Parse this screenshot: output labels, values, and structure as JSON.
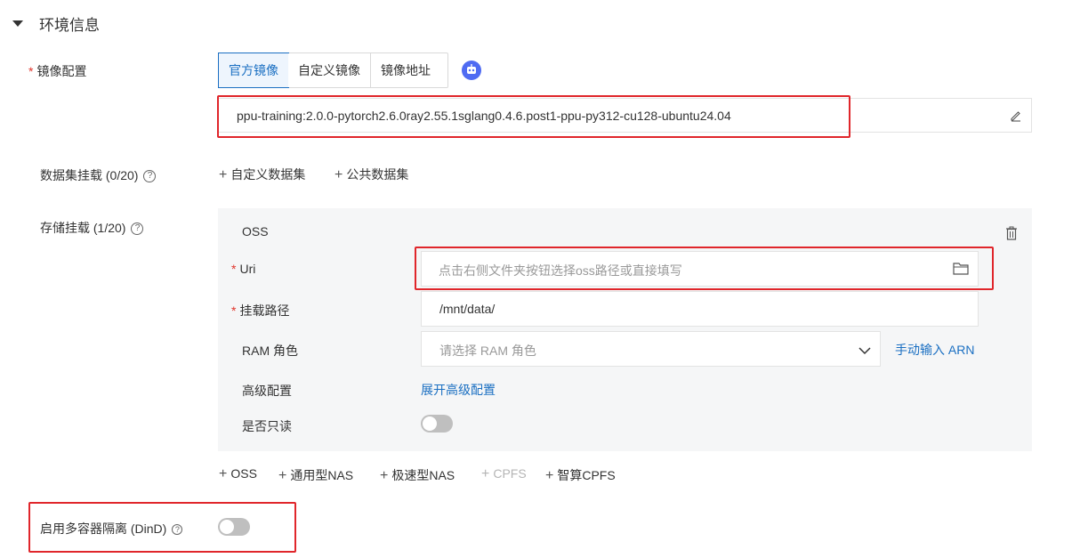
{
  "section": {
    "title": "环境信息"
  },
  "image_config": {
    "label": "镜像配置",
    "tabs": [
      "官方镜像",
      "自定义镜像",
      "镜像地址"
    ],
    "active_tab": "官方镜像",
    "value": "ppu-training:2.0.0-pytorch2.6.0ray2.55.1sglang0.4.6.post1-ppu-py312-cu128-ubuntu24.04"
  },
  "dataset_mount": {
    "label": "数据集挂载 (0/20)",
    "add_custom": "自定义数据集",
    "add_public": "公共数据集"
  },
  "storage_mount": {
    "label": "存储挂载 (1/20)",
    "card_title": "OSS",
    "uri_label": "Uri",
    "uri_placeholder": "点击右侧文件夹按钮选择oss路径或直接填写",
    "mount_path_label": "挂载路径",
    "mount_path_value": "/mnt/data/",
    "ram_role_label": "RAM 角色",
    "ram_role_placeholder": "请选择 RAM 角色",
    "ram_manual_link": "手动输入 ARN",
    "advanced_label": "高级配置",
    "advanced_link": "展开高级配置",
    "readonly_label": "是否只读",
    "readonly_on": false,
    "add_oss": "OSS",
    "add_nas_general": "通用型NAS",
    "add_nas_fast": "极速型NAS",
    "add_cpfs": "CPFS",
    "add_cpfs_smart": "智算CPFS"
  },
  "dind": {
    "label": "启用多容器隔离 (DinD)",
    "enabled": false
  },
  "colors": {
    "accent": "#1a6fc2",
    "required": "#e0342a",
    "highlight_box": "#e0262b",
    "card_bg": "#f5f6f7"
  },
  "icons": {
    "section_toggle": "caret-down-icon",
    "image_badge": "robot-icon",
    "edit": "edit-pen-icon",
    "delete": "trash-icon",
    "folder": "folder-icon",
    "dropdown": "chevron-down-icon",
    "help": "question-circle-icon"
  }
}
